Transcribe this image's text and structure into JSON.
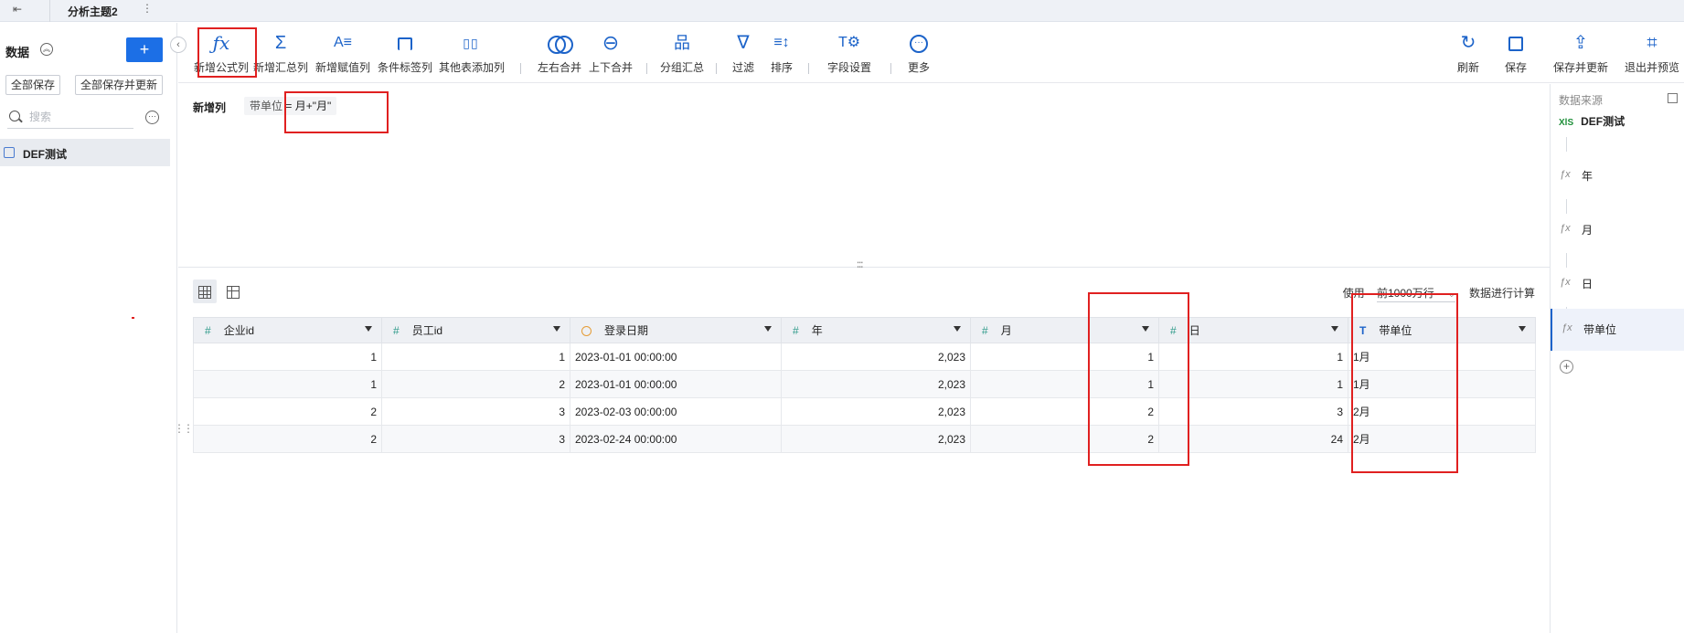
{
  "topbar": {
    "back_icon": "back-icon",
    "tab_title": "分析主题2",
    "more_symbol": "⋮"
  },
  "sidebar": {
    "title": "数据",
    "add_label": "+",
    "save_all_label": "全部保存",
    "save_all_update_label": "全部保存并更新",
    "search_placeholder": "搜索",
    "items": [
      {
        "label": "DEF测试",
        "icon": "dataset-icon"
      }
    ]
  },
  "toolbar": {
    "items": [
      {
        "label": "新增公式列",
        "icon": "formula-icon",
        "glyph": "ƒx"
      },
      {
        "label": "新增汇总列",
        "icon": "sum-icon",
        "glyph": "Σ"
      },
      {
        "label": "新增赋值列",
        "icon": "assign-icon",
        "glyph": "A≡"
      },
      {
        "label": "条件标签列",
        "icon": "tag-icon",
        "glyph": "⊓"
      },
      {
        "label": "其他表添加列",
        "icon": "add-column-icon",
        "glyph": "▯▯"
      },
      {
        "label": "左右合并",
        "icon": "merge-horizontal-icon",
        "glyph": ""
      },
      {
        "label": "上下合并",
        "icon": "merge-vertical-icon",
        "glyph": "⊖"
      },
      {
        "label": "分组汇总",
        "icon": "group-icon",
        "glyph": "品"
      },
      {
        "label": "过滤",
        "icon": "filter-icon",
        "glyph": "∇"
      },
      {
        "label": "排序",
        "icon": "sort-icon",
        "glyph": "≡↕"
      },
      {
        "label": "字段设置",
        "icon": "field-settings-icon",
        "glyph": "T⚙"
      },
      {
        "label": "更多",
        "icon": "more-icon",
        "glyph": "···"
      }
    ],
    "right_items": [
      {
        "label": "刷新",
        "icon": "refresh-icon",
        "glyph": "↻"
      },
      {
        "label": "保存",
        "icon": "save-icon",
        "glyph": "▣"
      },
      {
        "label": "保存并更新",
        "icon": "save-update-icon",
        "glyph": "⇪"
      },
      {
        "label": "退出并预览",
        "icon": "exit-preview-icon",
        "glyph": "⌗"
      }
    ]
  },
  "formula": {
    "label": "新增列",
    "field": "带单位",
    "expression": "= 月+\"月\""
  },
  "table_toolbar": {
    "use_label": "使用",
    "rows_option": "前1000万行",
    "calc_label": "数据进行计算"
  },
  "table": {
    "columns": [
      {
        "name": "企业id",
        "type": "number",
        "type_glyph": "#"
      },
      {
        "name": "员工id",
        "type": "number",
        "type_glyph": "#"
      },
      {
        "name": "登录日期",
        "type": "date",
        "type_glyph": ""
      },
      {
        "name": "年",
        "type": "number",
        "type_glyph": "#"
      },
      {
        "name": "月",
        "type": "number",
        "type_glyph": "#"
      },
      {
        "name": "日",
        "type": "number",
        "type_glyph": "#"
      },
      {
        "name": "带单位",
        "type": "text",
        "type_glyph": "T"
      }
    ],
    "rows": [
      [
        "1",
        "1",
        "2023-01-01 00:00:00",
        "2,023",
        "1",
        "1",
        "1月"
      ],
      [
        "1",
        "2",
        "2023-01-01 00:00:00",
        "2,023",
        "1",
        "1",
        "1月"
      ],
      [
        "2",
        "3",
        "2023-02-03 00:00:00",
        "2,023",
        "2",
        "3",
        "2月"
      ],
      [
        "2",
        "3",
        "2023-02-24 00:00:00",
        "2,023",
        "2",
        "24",
        "2月"
      ]
    ]
  },
  "right_panel": {
    "title": "数据来源",
    "source_badge": "XlS",
    "source_name": "DEF测试",
    "fx_symbol": "ƒx",
    "nodes": [
      {
        "name": "年",
        "selected": false
      },
      {
        "name": "月",
        "selected": false
      },
      {
        "name": "日",
        "selected": false
      },
      {
        "name": "带单位",
        "selected": true
      }
    ],
    "add_symbol": "+"
  },
  "colors": {
    "accent": "#1c63c9",
    "primary_button": "#1c6fe6",
    "annotation": "#e02020",
    "number_type": "#2f9a8a",
    "date_type": "#e59c36"
  }
}
